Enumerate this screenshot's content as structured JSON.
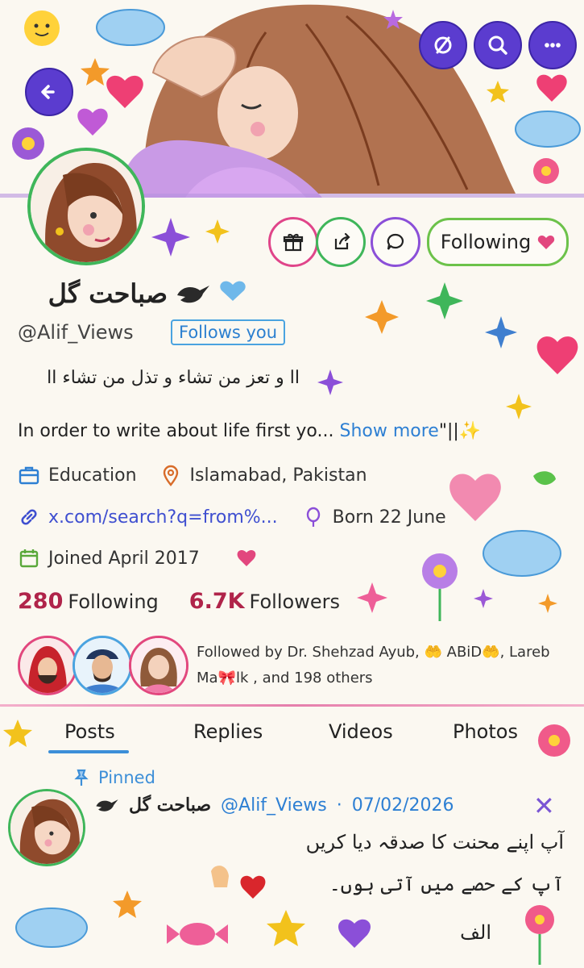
{
  "profile": {
    "display_name": "صباحت گل",
    "handle": "@Alif_Views",
    "follows_you": "Follows you",
    "bio_urdu": "اا و تعز من تشاء و تذل من تشاء اا",
    "bio_en": "In order to write about life first yo...",
    "show_more": "Show more",
    "bio_tail": "\"||✨",
    "category": "Education",
    "location": "Islamabad, Pakistan",
    "link": "x.com/search?q=from%...",
    "born": "Born 22 June",
    "joined": "Joined April 2017",
    "following_count": "280",
    "following_label": "Following",
    "followers_count": "6.7K",
    "followers_label": "Followers",
    "followed_by": "Followed by Dr. Shehzad Ayub, 🤲 ABiD🤲, Lareb Ma🎀lk , and 198 others"
  },
  "actions": {
    "following_button": "Following"
  },
  "tabs": [
    "Posts",
    "Replies",
    "Videos",
    "Photos"
  ],
  "post": {
    "pinned_label": "Pinned",
    "author_name": "صباحت گل",
    "author_handle": "@Alif_Views",
    "separator": "·",
    "date": "07/02/2026",
    "line1": "آپ اپنے محنت کا صدقہ دیا کریں",
    "line2": "آپ کے حصے میں آتی ہوں۔",
    "signature": "الف"
  },
  "colors": {
    "accent_purple": "#5b3ccf",
    "follow_green": "#6cc24a",
    "count_red": "#b0244a",
    "link_blue": "#2d7fd3"
  },
  "icons": [
    "back-arrow-icon",
    "no-notifications-icon",
    "search-icon",
    "more-icon",
    "gift-icon",
    "share-icon",
    "message-icon",
    "heart-icon",
    "briefcase-icon",
    "location-icon",
    "link-icon",
    "balloon-icon",
    "calendar-icon",
    "pin-icon",
    "close-icon",
    "bird-icon"
  ]
}
